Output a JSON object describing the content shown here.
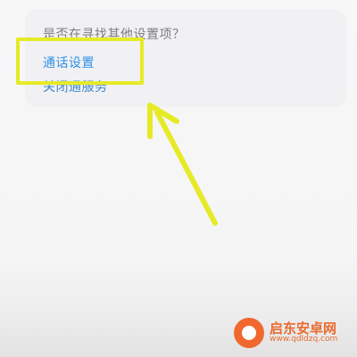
{
  "card": {
    "question": "是否在寻找其他设置项？",
    "links": [
      "通话设置",
      "关闭通服务"
    ]
  },
  "watermark": {
    "name": "启东安卓网",
    "url": "www.qdldzq.com"
  },
  "colors": {
    "highlight": "#e6ea26",
    "link": "#2f8fe8",
    "accent": "#e96b2e"
  }
}
